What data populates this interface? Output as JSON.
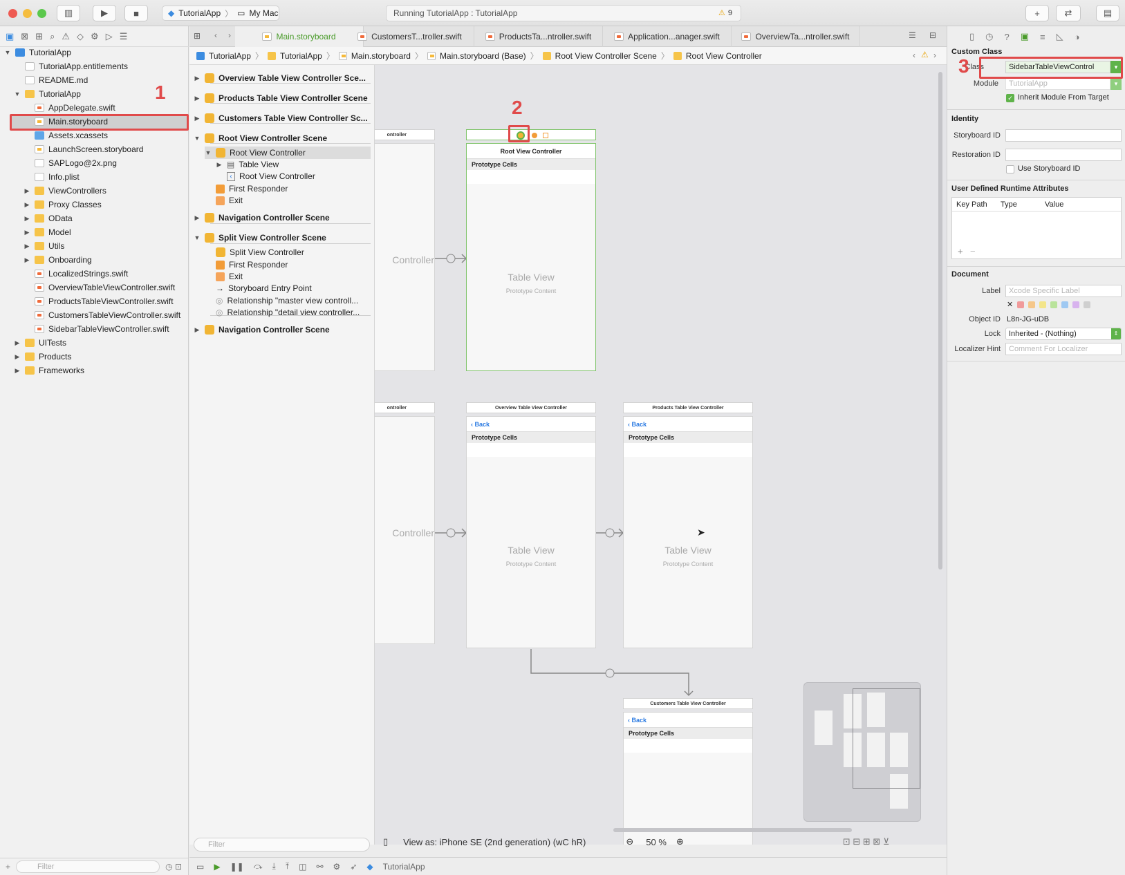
{
  "toolbar": {
    "scheme": "TutorialApp",
    "destination": "My Mac",
    "activity": "Running TutorialApp : TutorialApp",
    "warning_count": "9"
  },
  "navigator": {
    "items": [
      {
        "label": "TutorialApp",
        "kind": "project",
        "disclosure": "open"
      },
      {
        "label": "TutorialApp.entitlements",
        "kind": "gen"
      },
      {
        "label": "README.md",
        "kind": "gen"
      },
      {
        "label": "TutorialApp",
        "kind": "folder",
        "disclosure": "open"
      },
      {
        "label": "AppDelegate.swift",
        "kind": "swift"
      },
      {
        "label": "Main.storyboard",
        "kind": "sb"
      },
      {
        "label": "Assets.xcassets",
        "kind": "assets"
      },
      {
        "label": "LaunchScreen.storyboard",
        "kind": "sb"
      },
      {
        "label": "SAPLogo@2x.png",
        "kind": "gen"
      },
      {
        "label": "Info.plist",
        "kind": "gen"
      },
      {
        "label": "ViewControllers",
        "kind": "folder",
        "disclosure": "closed"
      },
      {
        "label": "Proxy Classes",
        "kind": "folder",
        "disclosure": "closed"
      },
      {
        "label": "OData",
        "kind": "folder",
        "disclosure": "closed"
      },
      {
        "label": "Model",
        "kind": "folder",
        "disclosure": "closed"
      },
      {
        "label": "Utils",
        "kind": "folder",
        "disclosure": "closed"
      },
      {
        "label": "Onboarding",
        "kind": "folder",
        "disclosure": "closed"
      },
      {
        "label": "LocalizedStrings.swift",
        "kind": "swift"
      },
      {
        "label": "OverviewTableViewController.swift",
        "kind": "swift"
      },
      {
        "label": "ProductsTableViewController.swift",
        "kind": "swift"
      },
      {
        "label": "CustomersTableViewController.swift",
        "kind": "swift"
      },
      {
        "label": "SidebarTableViewController.swift",
        "kind": "swift"
      },
      {
        "label": "UITests",
        "kind": "folder",
        "disclosure": "closed"
      },
      {
        "label": "Products",
        "kind": "folder",
        "disclosure": "closed"
      },
      {
        "label": "Frameworks",
        "kind": "folder",
        "disclosure": "closed"
      }
    ],
    "filter_placeholder": "Filter"
  },
  "tabs": [
    "Main.storyboard",
    "CustomersT...troller.swift",
    "ProductsTa...ntroller.swift",
    "Application...anager.swift",
    "OverviewTa...ntroller.swift"
  ],
  "jumpbar": [
    "TutorialApp",
    "TutorialApp",
    "Main.storyboard",
    "Main.storyboard (Base)",
    "Root View Controller Scene",
    "Root View Controller"
  ],
  "outline": [
    {
      "label": "Overview Table View Controller Sce...",
      "bold": true,
      "disc": "closed"
    },
    {
      "label": "Products Table View Controller Scene",
      "bold": true,
      "disc": "closed"
    },
    {
      "label": "Customers Table View Controller Sc...",
      "bold": true,
      "disc": "closed"
    },
    {
      "label": "Root View Controller Scene",
      "bold": true,
      "disc": "open"
    },
    {
      "label": "Root View Controller",
      "bold": false,
      "disc": "open"
    },
    {
      "label": "Table View",
      "bold": false,
      "disc": "closed"
    },
    {
      "label": "Root View Controller",
      "bold": false
    },
    {
      "label": "First Responder",
      "bold": false
    },
    {
      "label": "Exit",
      "bold": false
    },
    {
      "label": "Navigation Controller Scene",
      "bold": true,
      "disc": "closed"
    },
    {
      "label": "Split View Controller Scene",
      "bold": true,
      "disc": "open"
    },
    {
      "label": "Split View Controller",
      "bold": false
    },
    {
      "label": "First Responder",
      "bold": false
    },
    {
      "label": "Exit",
      "bold": false
    },
    {
      "label": "Storyboard Entry Point",
      "bold": false
    },
    {
      "label": "Relationship \"master view controll...",
      "bold": false
    },
    {
      "label": "Relationship \"detail view controller...",
      "bold": false
    },
    {
      "label": "Navigation Controller Scene",
      "bold": true,
      "disc": "closed"
    }
  ],
  "outline_filter": "Filter",
  "canvas": {
    "root": {
      "title": "Root View Controller",
      "proto": "Prototype Cells",
      "tv": "Table View",
      "tv_sub": "Prototype Content"
    },
    "partial_top_title": "ontroller",
    "partial_label": "Controller",
    "overview": {
      "title": "Overview Table View Controller",
      "back": "Back",
      "proto": "Prototype Cells",
      "tv": "Table View",
      "tv_sub": "Prototype Content"
    },
    "products": {
      "title": "Products Table View Controller",
      "back": "Back",
      "proto": "Prototype Cells",
      "tv": "Table View",
      "tv_sub": "Prototype Content"
    },
    "customers": {
      "title": "Customers Table View Controller",
      "back": "Back",
      "proto": "Prototype Cells"
    }
  },
  "zoom": {
    "view_as": "View as: iPhone SE (2nd generation) (wC hR)",
    "level": "50 %"
  },
  "debug": {
    "target": "TutorialApp"
  },
  "inspector": {
    "custom_class_title": "Custom Class",
    "class_label": "Class",
    "class_value": "SidebarTableViewControl",
    "module_label": "Module",
    "module_placeholder": "TutorialApp",
    "inherit_label": "Inherit Module From Target",
    "identity_title": "Identity",
    "storyboard_id_label": "Storyboard ID",
    "restoration_id_label": "Restoration ID",
    "use_storyboard_id_label": "Use Storyboard ID",
    "udra_title": "User Defined Runtime Attributes",
    "udra_cols": [
      "Key Path",
      "Type",
      "Value"
    ],
    "document_title": "Document",
    "label_label": "Label",
    "label_placeholder": "Xcode Specific Label",
    "object_id_label": "Object ID",
    "object_id": "L8n-JG-uDB",
    "lock_label": "Lock",
    "lock_value": "Inherited - (Nothing)",
    "localizer_label": "Localizer Hint",
    "localizer_placeholder": "Comment For Localizer"
  },
  "annotations": [
    "1",
    "2",
    "3"
  ],
  "colors": {
    "accent_green": "#4a9b2a",
    "highlight_red": "#e04a4a",
    "folder_yellow": "#f6c449"
  }
}
